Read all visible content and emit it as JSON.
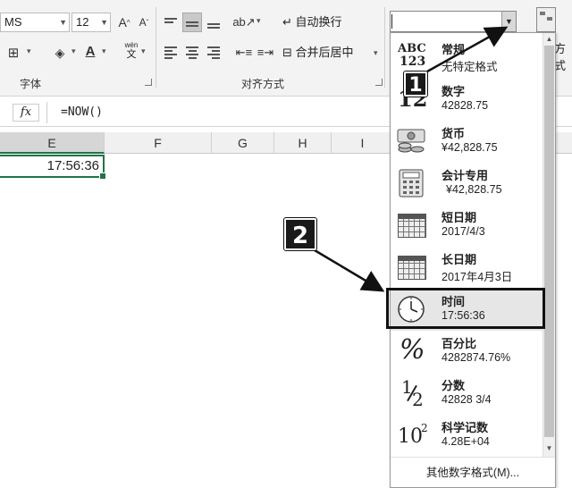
{
  "ribbon": {
    "font_name": "MS",
    "font_size": "12",
    "grow_font": "A",
    "shrink_font": "A",
    "phonetic_top": "wén",
    "phonetic_bottom": "文",
    "wrap_text": "自动换行",
    "merge_center": "合并后居中",
    "group_font": "字体",
    "group_align": "对齐方式",
    "number_format_value": "",
    "cond_label": "方式"
  },
  "formula_bar": {
    "fx": "fx",
    "formula": "=NOW()"
  },
  "columns": [
    "E",
    "F",
    "G",
    "H",
    "I"
  ],
  "cell_value": "17:56:36",
  "format_menu": {
    "items": [
      {
        "name": "常规",
        "example": "无特定格式",
        "icon": "abc-123-icon"
      },
      {
        "name": "数字",
        "example": "42828.75",
        "icon": "number-12-icon"
      },
      {
        "name": "货币",
        "example": "¥42,828.75",
        "icon": "currency-icon"
      },
      {
        "name": "会计专用",
        "example": "¥42,828.75",
        "icon": "accounting-icon"
      },
      {
        "name": "短日期",
        "example": "2017/4/3",
        "icon": "calendar-icon"
      },
      {
        "name": "长日期",
        "example": "2017年4月3日",
        "icon": "calendar-icon"
      },
      {
        "name": "时间",
        "example": "17:56:36",
        "icon": "clock-icon"
      },
      {
        "name": "百分比",
        "example": "4282874.76%",
        "icon": "percent-icon"
      },
      {
        "name": "分数",
        "example": "42828 3/4",
        "icon": "fraction-icon"
      },
      {
        "name": "科学记数",
        "example": "4.28E+04",
        "icon": "scientific-icon"
      }
    ],
    "more": "其他数字格式(M)..."
  },
  "icon_text": {
    "abc": "ABC",
    "n123": "123",
    "n12": "12",
    "pct": "%",
    "frac_num": "1",
    "frac_den": "2",
    "sci_base": "10",
    "sci_exp": "2"
  },
  "callouts": {
    "one": "1",
    "two": "2"
  }
}
